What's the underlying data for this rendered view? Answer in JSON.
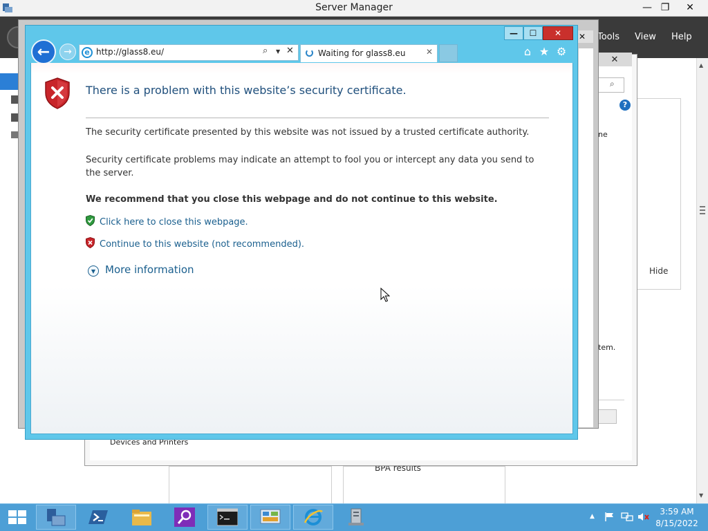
{
  "server_manager": {
    "title": "Server Manager",
    "controls": {
      "minimize": "—",
      "restore": "❐",
      "close": "✕"
    },
    "menu": {
      "tools": "Tools",
      "view": "View",
      "help": "Help"
    },
    "hide_label": "Hide",
    "bpa_label": "BPA results",
    "devices_label": "Devices and Printers",
    "right_text_1": "ne",
    "right_text_2": "tem.",
    "help_glyph": "?"
  },
  "background_dialog": {
    "close": "✕",
    "close2": "✕"
  },
  "ie": {
    "address_url": "http://glass8.eu/",
    "tab_title": "Waiting for glass8.eu",
    "tab_close": "✕",
    "stop_glyph": "✕",
    "search_glyph": "⌕",
    "dropdown_glyph": "▼",
    "window": {
      "minimize": "—",
      "maximize": "☐",
      "close": "✕"
    },
    "tools": {
      "home": "⌂",
      "favorites": "★",
      "settings": "⚙"
    },
    "back_glyph": "←",
    "forward_glyph": "→"
  },
  "cert_error": {
    "title": "There is a problem with this website’s security certificate.",
    "paragraph_1": "The security certificate presented by this website was not issued by a trusted certificate authority.",
    "paragraph_2": "Security certificate problems may indicate an attempt to fool you or intercept any data you send to the server.",
    "recommendation": "We recommend that you close this webpage and do not continue to this website.",
    "close_link": "Click here to close this webpage.",
    "continue_link": "Continue to this website (not recommended).",
    "more_info": "More information",
    "more_glyph": "▼"
  },
  "taskbar": {
    "time": "3:59 AM",
    "date": "8/15/2022",
    "tray_up_glyph": "▲",
    "apps": [
      "server-manager",
      "powershell",
      "file-explorer",
      "search-tool",
      "command-prompt",
      "control-panel",
      "internet-explorer",
      "server-tool"
    ]
  },
  "colors": {
    "ie_frame": "#5fc7ea",
    "link": "#1a5f8e",
    "title": "#1f4f7c",
    "taskbar": "#4d9fd6",
    "close_red": "#c9302c"
  }
}
